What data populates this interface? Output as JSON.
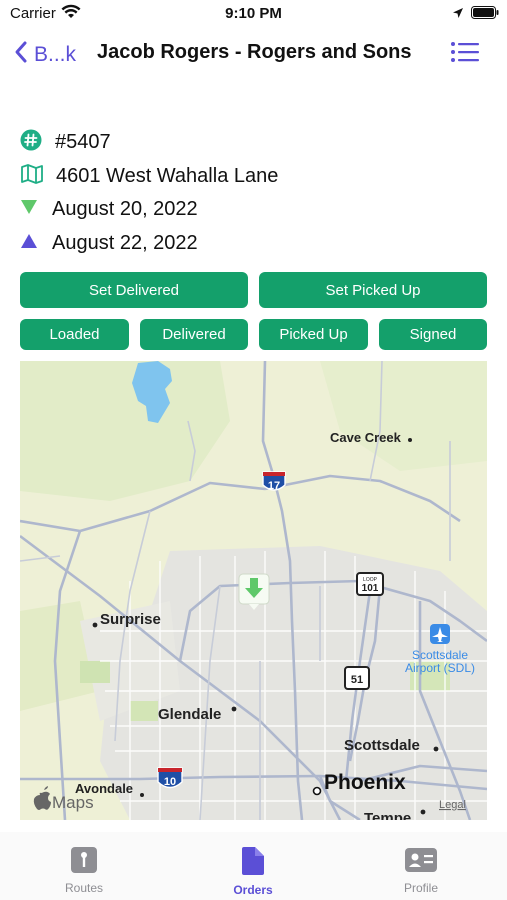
{
  "status_bar": {
    "carrier": "Carrier",
    "time": "9:10 PM"
  },
  "nav": {
    "back_label": "B...k",
    "title": "Jacob Rogers - Rogers and Sons"
  },
  "order": {
    "number": "#5407",
    "address": "4601 West Wahalla Lane",
    "start_date": "August 20, 2022",
    "end_date": "August 22, 2022"
  },
  "actions": {
    "set_delivered": "Set Delivered",
    "set_picked_up": "Set Picked Up",
    "loaded": "Loaded",
    "delivered": "Delivered",
    "picked_up": "Picked Up",
    "signed": "Signed"
  },
  "map": {
    "places": {
      "cave_creek": "Cave Creek",
      "surprise": "Surprise",
      "glendale": "Glendale",
      "scottsdale": "Scottsdale",
      "avondale": "Avondale",
      "phoenix": "Phoenix",
      "tempe": "Tempe",
      "airport_line1": "Scottsdale",
      "airport_line2": "Airport (SDL)"
    },
    "shields": {
      "i17": "17",
      "loop101_top": "LOOP",
      "loop101": "101",
      "sr51": "51",
      "i10": "10"
    },
    "attribution": "Maps",
    "legal": "Legal"
  },
  "tabs": {
    "routes": "Routes",
    "orders": "Orders",
    "profile": "Profile"
  },
  "colors": {
    "accent": "#5b4fd6",
    "button_green": "#14a06b",
    "icon_teal": "#1fae86",
    "tab_inactive": "#8e8e93"
  }
}
